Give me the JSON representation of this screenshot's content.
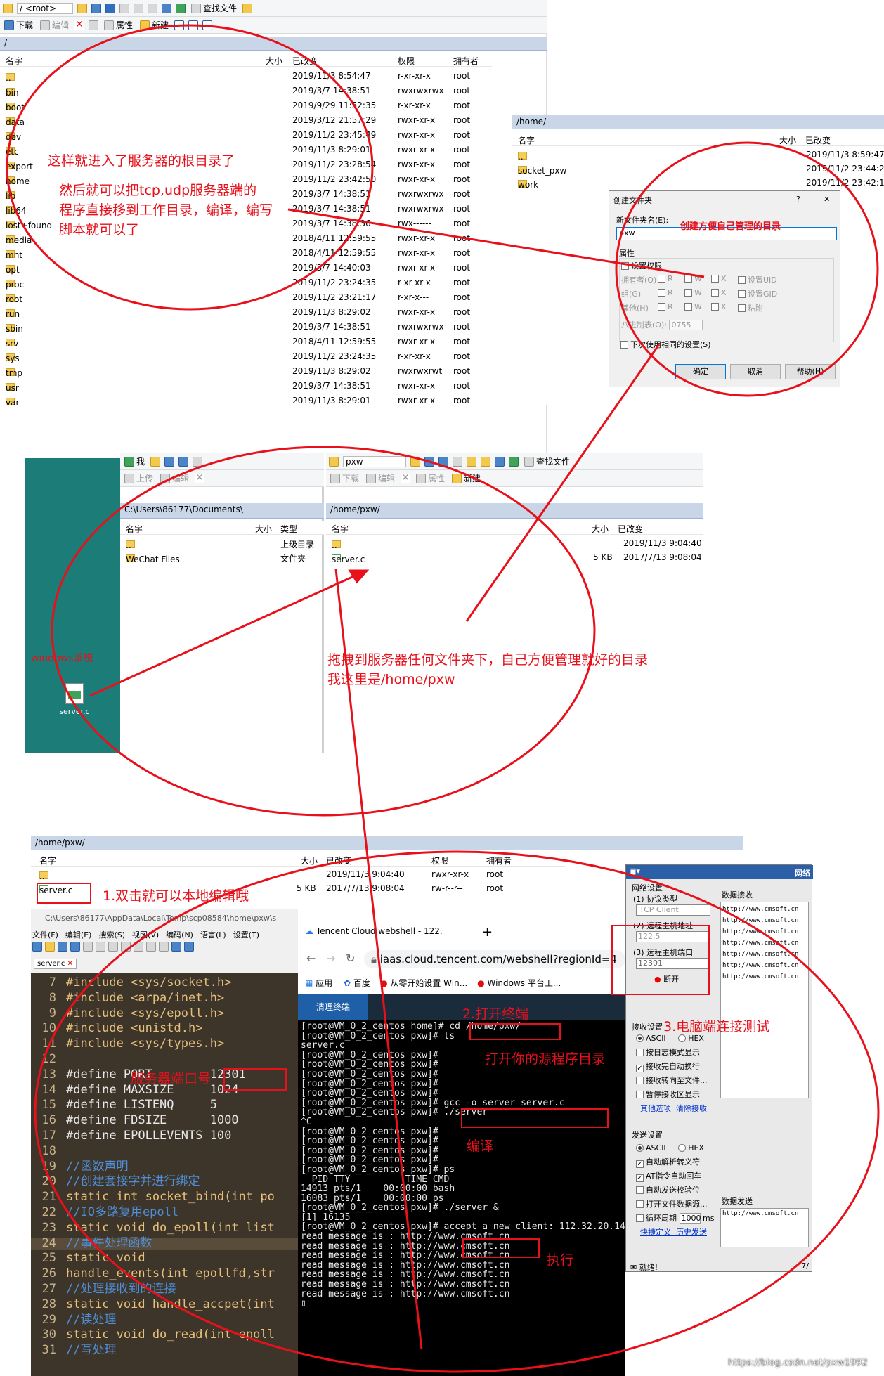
{
  "top_window": {
    "address": "/ <root>",
    "toolbar_items": [
      "查找文件"
    ],
    "toolbar2": [
      "下载",
      "编辑",
      "属性",
      "新建"
    ],
    "path": "/",
    "headers": [
      "名字",
      "大小",
      "已改变",
      "权限",
      "拥有者"
    ],
    "rows": [
      {
        "name": "..",
        "date": "2019/11/3 8:54:47",
        "perm": "r-xr-xr-x",
        "owner": "root"
      },
      {
        "name": "bin",
        "date": "2019/3/7 14:38:51",
        "perm": "rwxrwxrwx",
        "owner": "root"
      },
      {
        "name": "boot",
        "date": "2019/9/29 11:52:35",
        "perm": "r-xr-xr-x",
        "owner": "root"
      },
      {
        "name": "data",
        "date": "2019/3/12 21:57:29",
        "perm": "rwxr-xr-x",
        "owner": "root"
      },
      {
        "name": "dev",
        "date": "2019/11/2 23:45:49",
        "perm": "rwxr-xr-x",
        "owner": "root"
      },
      {
        "name": "etc",
        "date": "2019/11/3 8:29:01",
        "perm": "rwxr-xr-x",
        "owner": "root"
      },
      {
        "name": "export",
        "date": "2019/11/2 23:28:54",
        "perm": "rwxr-xr-x",
        "owner": "root"
      },
      {
        "name": "home",
        "date": "2019/11/2 23:42:50",
        "perm": "rwxr-xr-x",
        "owner": "root"
      },
      {
        "name": "lib",
        "date": "2019/3/7 14:38:51",
        "perm": "rwxrwxrwx",
        "owner": "root"
      },
      {
        "name": "lib64",
        "date": "2019/3/7 14:38:51",
        "perm": "rwxrwxrwx",
        "owner": "root"
      },
      {
        "name": "lost+found",
        "date": "2019/3/7 14:38:36",
        "perm": "rwx------",
        "owner": "root"
      },
      {
        "name": "media",
        "date": "2018/4/11 12:59:55",
        "perm": "rwxr-xr-x",
        "owner": "root"
      },
      {
        "name": "mnt",
        "date": "2018/4/11 12:59:55",
        "perm": "rwxr-xr-x",
        "owner": "root"
      },
      {
        "name": "opt",
        "date": "2019/3/7 14:40:03",
        "perm": "rwxr-xr-x",
        "owner": "root"
      },
      {
        "name": "proc",
        "date": "2019/11/2 23:24:35",
        "perm": "r-xr-xr-x",
        "owner": "root"
      },
      {
        "name": "root",
        "date": "2019/11/2 23:21:17",
        "perm": "r-xr-x---",
        "owner": "root"
      },
      {
        "name": "run",
        "date": "2019/11/3 8:29:02",
        "perm": "rwxr-xr-x",
        "owner": "root"
      },
      {
        "name": "sbin",
        "date": "2019/3/7 14:38:51",
        "perm": "rwxrwxrwx",
        "owner": "root"
      },
      {
        "name": "srv",
        "date": "2018/4/11 12:59:55",
        "perm": "rwxr-xr-x",
        "owner": "root"
      },
      {
        "name": "sys",
        "date": "2019/11/2 23:24:35",
        "perm": "r-xr-xr-x",
        "owner": "root"
      },
      {
        "name": "tmp",
        "date": "2019/11/3 8:29:02",
        "perm": "rwxrwxrwt",
        "owner": "root"
      },
      {
        "name": "usr",
        "date": "2019/3/7 14:38:51",
        "perm": "rwxr-xr-x",
        "owner": "root"
      },
      {
        "name": "var",
        "date": "2019/11/3 8:29:01",
        "perm": "rwxr-xr-x",
        "owner": "root"
      }
    ]
  },
  "home_window": {
    "path": "/home/",
    "headers": [
      "名字",
      "大小",
      "已改变"
    ],
    "rows": [
      {
        "name": "..",
        "date": "2019/11/3 8:59:47"
      },
      {
        "name": "socket_pxw",
        "date": "2019/11/2 23:44:27"
      },
      {
        "name": "work",
        "date": "2019/11/2 23:42:10"
      }
    ]
  },
  "mkdir_dialog": {
    "title": "创建文件夹",
    "help": "?",
    "close": "✕",
    "name_label": "新文件夹名(E):",
    "name_value": "pxw",
    "props_label": "属性",
    "set_perm": "设置权限",
    "owner_label": "拥有者(O)",
    "group_label": "组(G)",
    "other_label": "其他(H)",
    "r": "R",
    "w": "W",
    "x": "X",
    "uid": "设置UID",
    "gid": "设置GID",
    "sticky": "粘附",
    "octal_label": "八进制表(O):",
    "octal_value": "0755",
    "reuse": "下次使用相同的设置(S)",
    "ok": "确定",
    "cancel": "取消",
    "help_btn": "帮助(H)"
  },
  "middle": {
    "left_path": "C:\\Users\\86177\\Documents\\",
    "left_toolbar": [
      "我",
      "上传",
      "编辑"
    ],
    "left_headers": [
      "名字",
      "大小",
      "类型"
    ],
    "left_rows": [
      {
        "name": "..",
        "type": "上级目录"
      },
      {
        "name": "WeChat Files",
        "type": "文件夹"
      }
    ],
    "right_address": "pxw",
    "right_toolbar": [
      "查找文件",
      "下载",
      "编辑",
      "属性",
      "新建"
    ],
    "right_path": "/home/pxw/",
    "right_headers": [
      "名字",
      "大小",
      "已改变"
    ],
    "right_rows": [
      {
        "name": "..",
        "size": "",
        "date": "2019/11/3 9:04:40"
      },
      {
        "name": "server.c",
        "size": "5 KB",
        "date": "2017/7/13 9:08:04"
      }
    ],
    "desktop_icon": "server.c",
    "windows_label": "windows系统"
  },
  "bottom_panel": {
    "path": "/home/pxw/",
    "headers": [
      "名字",
      "大小",
      "已改变",
      "权限",
      "拥有者"
    ],
    "rows": [
      {
        "name": "..",
        "size": "",
        "date": "2019/11/3 9:04:40",
        "perm": "rwxr-xr-x",
        "owner": "root"
      },
      {
        "name": "server.c",
        "size": "5 KB",
        "date": "2017/7/13 9:08:04",
        "perm": "rw-r--r--",
        "owner": "root"
      }
    ]
  },
  "editor": {
    "title_path": "C:\\Users\\86177\\AppData\\Local\\Temp\\scp08584\\home\\pxw\\s",
    "menu": [
      "文件(F)",
      "编辑(E)",
      "搜索(S)",
      "视图(V)",
      "编码(N)",
      "语言(L)",
      "设置(T)"
    ],
    "tab": "server.c",
    "lines": [
      {
        "n": "7",
        "t": "#include <sys/socket.h>",
        "c": "inc"
      },
      {
        "n": "8",
        "t": "#include <arpa/inet.h>",
        "c": "inc"
      },
      {
        "n": "9",
        "t": "#include <sys/epoll.h>",
        "c": "inc"
      },
      {
        "n": "10",
        "t": "#include <unistd.h>",
        "c": "inc"
      },
      {
        "n": "11",
        "t": "#include <sys/types.h>",
        "c": "inc"
      },
      {
        "n": "12",
        "t": "",
        "c": "def"
      },
      {
        "n": "13",
        "t": "#define PORT        12301",
        "c": "def"
      },
      {
        "n": "14",
        "t": "#define MAXSIZE     1024",
        "c": "def"
      },
      {
        "n": "15",
        "t": "#define LISTENQ     5",
        "c": "def"
      },
      {
        "n": "16",
        "t": "#define FDSIZE      1000",
        "c": "def"
      },
      {
        "n": "17",
        "t": "#define EPOLLEVENTS 100",
        "c": "def"
      },
      {
        "n": "18",
        "t": "",
        "c": "def"
      },
      {
        "n": "19",
        "t": "//函数声明",
        "c": "com"
      },
      {
        "n": "20",
        "t": "//创建套接字并进行绑定",
        "c": "com"
      },
      {
        "n": "21",
        "t": "static int socket_bind(int po",
        "c": "kw"
      },
      {
        "n": "22",
        "t": "//IO多路复用epoll",
        "c": "com"
      },
      {
        "n": "23",
        "t": "static void do_epoll(int list",
        "c": "kw"
      },
      {
        "n": "24",
        "t": "//事件处理函数",
        "c": "com"
      },
      {
        "n": "25",
        "t": "static void",
        "c": "kw"
      },
      {
        "n": "26",
        "t": "handle_events(int epollfd,str",
        "c": "kw"
      },
      {
        "n": "27",
        "t": "//处理接收到的连接",
        "c": "com"
      },
      {
        "n": "28",
        "t": "static void handle_accpet(int",
        "c": "kw"
      },
      {
        "n": "29",
        "t": "//读处理",
        "c": "com"
      },
      {
        "n": "30",
        "t": "static void do_read(int epoll",
        "c": "kw"
      },
      {
        "n": "31",
        "t": "//写处理",
        "c": "com"
      }
    ]
  },
  "browser": {
    "tab_title": "Tencent Cloud webshell - 122.",
    "url": "iaas.cloud.tencent.com/webshell?regionId=4",
    "bookmarks": [
      "应用",
      "百度",
      "从零开始设置 Win...",
      "Windows 平台工..."
    ],
    "clear_btn": "清理终端",
    "terminal": "[root@VM_0_2_centos home]# cd /home/pxw/\n[root@VM_0_2_centos pxw]# ls\nserver.c\n[root@VM_0_2_centos pxw]#\n[root@VM_0_2_centos pxw]#\n[root@VM_0_2_centos pxw]#\n[root@VM_0_2_centos pxw]#\n[root@VM_0_2_centos pxw]#\n[root@VM_0_2_centos pxw]# gcc -o server server.c\n[root@VM_0_2_centos pxw]# ./server\n^C\n[root@VM_0_2_centos pxw]#\n[root@VM_0_2_centos pxw]#\n[root@VM_0_2_centos pxw]#\n[root@VM_0_2_centos pxw]#\n[root@VM_0_2_centos pxw]# ps\n  PID TTY          TIME CMD\n14913 pts/1    00:00:00 bash\n16083 pts/1    00:00:00 ps\n[root@VM_0_2_centos pxw]# ./server &\n[1] 16135\n[root@VM_0_2_centos pxw]# accept a new client: 112.32.20.14:47738\nread message is : http://www.cmsoft.cn\nread message is : http://www.cmsoft.cn\nread message is : http://www.cmsoft.cn\nread message is : http://www.cmsoft.cn\nread message is : http://www.cmsoft.cn\nread message is : http://www.cmsoft.cn\nread message is : http://www.cmsoft.cn\n▯"
  },
  "net_tool": {
    "title": "网络",
    "net_settings": "网络设置",
    "proto_label": "(1) 协议类型",
    "proto_value": "TCP Client",
    "host_label": "(2) 远程主机地址",
    "host_value": "122.5",
    "port_label": "(3) 远程主机端口",
    "port_value": "12301",
    "disconnect": "断开",
    "recv_title": "数据接收",
    "recv_lines": [
      "http://www.cmsoft.cn",
      "http://www.cmsoft.cn",
      "http://www.cmsoft.cn",
      "http://www.cmsoft.cn",
      "http://www.cmsoft.cn",
      "http://www.cmsoft.cn",
      "http://www.cmsoft.cn"
    ],
    "recv_settings": "接收设置",
    "ascii": "ASCII",
    "hex": "HEX",
    "recv_opts": [
      "按日志模式显示",
      "接收完自动换行",
      "接收转向至文件...",
      "暂停接收区显示"
    ],
    "recv_links": [
      "其他选项",
      "清除接收"
    ],
    "send_settings": "发送设置",
    "send_opts": [
      "自动解析转义符",
      "AT指令自动回车",
      "自动发送校验位",
      "打开文件数据源...",
      "循环周期"
    ],
    "period_value": "1000",
    "period_unit": "ms",
    "send_links": [
      "快捷定义",
      "历史发送"
    ],
    "send_title": "数据发送",
    "send_text": "http://www.cmsoft.cn",
    "status": "就绪!",
    "counter": "7/"
  },
  "annotations": {
    "a1": "这样就进入了服务器的根目录了",
    "a2": "然后就可以把tcp,udp服务器端的",
    "a3": "程序直接移到工作目录，编译，编写",
    "a4": "脚本就可以了",
    "a5": "创建方便自己管理的目录",
    "a6": "拖拽到服务器任何文件夹下，自己方便管理就好的目录",
    "a7": "我这里是/home/pxw",
    "a8": "1.双击就可以本地编辑哦",
    "a9": "服务器端口号",
    "a10": "2.打开终端",
    "a11": "打开你的源程序目录",
    "a12": "3.电脑端连接测试",
    "a13": "编译",
    "a14": "执行"
  },
  "watermark": "https://blog.csdn.net/pxw1992"
}
